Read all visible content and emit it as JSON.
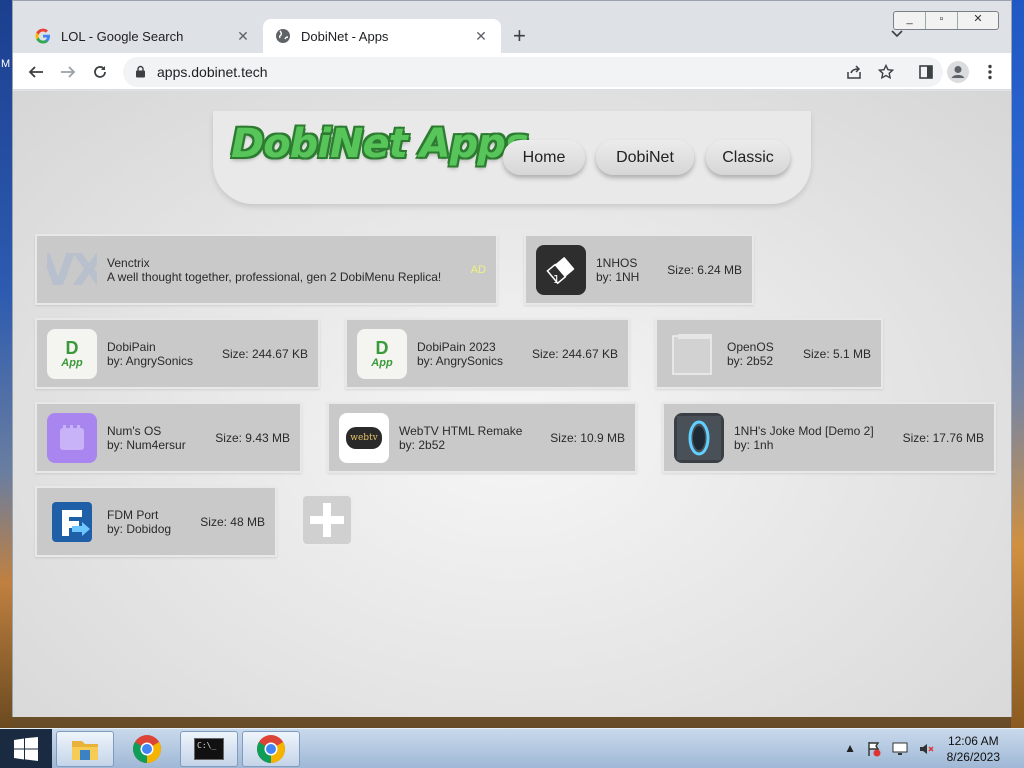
{
  "desktop": {
    "edge_text": "M"
  },
  "window": {
    "controls": [
      "_",
      "▫",
      "✕"
    ]
  },
  "tabs": [
    {
      "title": "LOL - Google Search",
      "icon": "google-icon"
    },
    {
      "title": "DobiNet - Apps",
      "icon": "globe-icon"
    }
  ],
  "toolbar": {
    "url": "apps.dobinet.tech"
  },
  "site": {
    "logo": "DobiNet Apps",
    "nav": [
      "Home",
      "DobiNet",
      "Classic"
    ]
  },
  "ad_card": {
    "logo_text": "VX",
    "name": "Venctrix",
    "description": "A well thought together, professional, gen 2 DobiMenu Replica!",
    "badge": "AD"
  },
  "apps": [
    {
      "name": "1NHOS",
      "author": "by: 1NH",
      "size": "Size: 6.24 MB",
      "icon": "1nhos-icon"
    },
    {
      "name": "DobiPain",
      "author": "by: AngrySonics",
      "size": "Size: 244.67 KB",
      "icon": "dobipain-icon",
      "icon_text": "D",
      "icon_sub": "App"
    },
    {
      "name": "DobiPain 2023",
      "author": "by: AngrySonics",
      "size": "Size: 244.67 KB",
      "icon": "dobipain-icon",
      "icon_text": "D",
      "icon_sub": "App"
    },
    {
      "name": "OpenOS",
      "author": "by: 2b52",
      "size": "Size: 5.1 MB",
      "icon": "window-icon"
    },
    {
      "name": "Num's OS",
      "author": "by: Num4ersur",
      "size": "Size: 9.43 MB",
      "icon": "purple-folder-icon"
    },
    {
      "name": "WebTV HTML Remake",
      "author": "by: 2b52",
      "size": "Size: 10.9 MB",
      "icon": "webtv-icon",
      "icon_text": "webtv"
    },
    {
      "name": "1NH's Joke Mod [Demo 2]",
      "author": "by: 1nh",
      "size": "Size: 17.76 MB",
      "icon": "portal-icon"
    },
    {
      "name": "FDM Port",
      "author": "by: Dobidog",
      "size": "Size: 48 MB",
      "icon": "fdm-icon"
    }
  ],
  "taskbar": {
    "time": "12:06 AM",
    "date": "8/26/2023",
    "cmd_text": "C:\\_"
  }
}
